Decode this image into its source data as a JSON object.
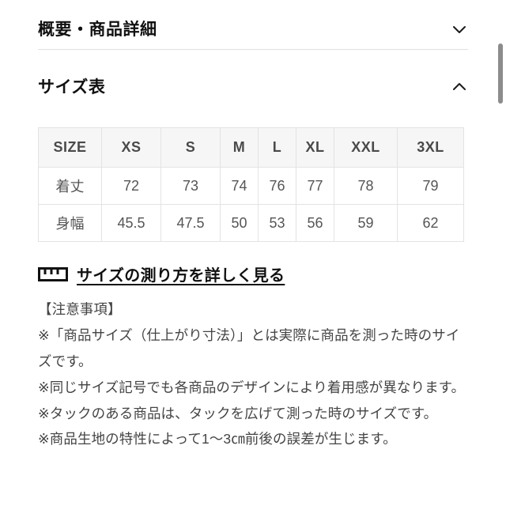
{
  "sections": [
    {
      "title": "概要・商品詳細",
      "state": "collapsed",
      "icon": "chevron-down-icon"
    },
    {
      "title": "サイズ表",
      "state": "expanded",
      "icon": "chevron-up-icon"
    }
  ],
  "size_table": {
    "headers": [
      "SIZE",
      "XS",
      "S",
      "M",
      "L",
      "XL",
      "XXL",
      "3XL"
    ],
    "rows": [
      {
        "label": "着丈",
        "values": [
          "72",
          "73",
          "74",
          "76",
          "77",
          "78",
          "79"
        ]
      },
      {
        "label": "身幅",
        "values": [
          "45.5",
          "47.5",
          "50",
          "53",
          "56",
          "59",
          "62"
        ]
      }
    ]
  },
  "measure_link": {
    "icon": "ruler-icon",
    "label": "サイズの測り方を詳しく見る"
  },
  "notes": {
    "heading": "【注意事項】",
    "lines": [
      "※「商品サイズ（仕上がり寸法）」とは実際に商品を測った時のサイズです。",
      "※同じサイズ記号でも各商品のデザインにより着用感が異なります。",
      "※タックのある商品は、タックを広げて測った時のサイズです。",
      "※商品生地の特性によって1〜3㎝前後の誤差が生じます。"
    ]
  },
  "scrollbar": {
    "name": "vertical-scrollbar"
  },
  "colors": {
    "text": "#111111",
    "muted": "#555555",
    "divider": "#e0e0e0",
    "table_border": "#e3e3e3",
    "table_header_bg": "#f6f6f6",
    "scrollbar_thumb": "#8c8c8c"
  }
}
